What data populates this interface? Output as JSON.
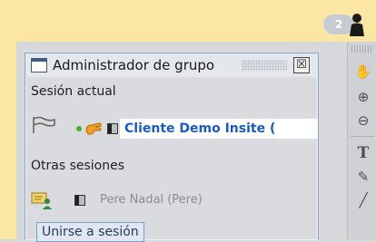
{
  "window": {
    "title": "Administrador de grupo",
    "close_glyph": "☒"
  },
  "current_session": {
    "heading": "Sesión actual",
    "name": "Cliente Demo Insite (",
    "icons": [
      "pointer-hand-icon",
      "status-dot-icon",
      "raise-hand-icon",
      "screen-icon"
    ]
  },
  "other_sessions": {
    "heading": "Otras sesiones",
    "items": [
      {
        "name": "Pere Nadal (Pere)",
        "icons": [
          "presenter-icon",
          "screen-icon"
        ]
      }
    ]
  },
  "join_button": {
    "label": "Unirse a sesión"
  },
  "user_badge": {
    "count": "2"
  },
  "toolbar": {
    "tools": [
      {
        "name": "hand-tool-icon",
        "glyph": "✋"
      },
      {
        "name": "zoom-in-icon",
        "glyph": "⊕"
      },
      {
        "name": "zoom-out-icon",
        "glyph": "⊖"
      },
      {
        "name": "text-tool-icon",
        "glyph": "T"
      },
      {
        "name": "pen-tool-icon",
        "glyph": "✎"
      },
      {
        "name": "line-tool-icon",
        "glyph": "╱"
      }
    ]
  },
  "colors": {
    "accent_yellow": "#fbe6a4",
    "session_text": "#1b5bbf",
    "panel_border": "#8ea6c6"
  }
}
